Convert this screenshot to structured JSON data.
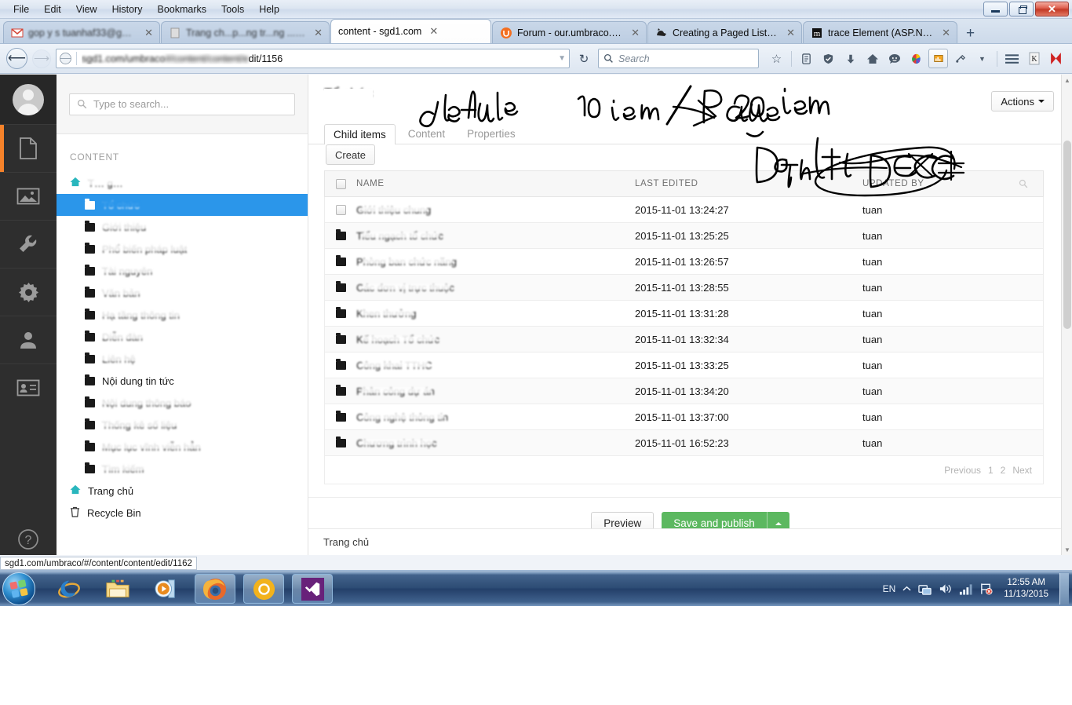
{
  "browser": {
    "menus": [
      "File",
      "Edit",
      "View",
      "History",
      "Bookmarks",
      "Tools",
      "Help"
    ],
    "window_controls": {
      "minimize": "Minimize",
      "restore": "Restore",
      "close": "Close"
    },
    "tabs": [
      {
        "title": "gop y s   tuanhaf33@gmc...",
        "favicon": "gmail-icon",
        "redacted": true,
        "active": false
      },
      {
        "title": "Trang ch...p...ng tr...ng ...n diểm",
        "favicon": "page-icon",
        "redacted": true,
        "active": false
      },
      {
        "title": "content - sgd1.com",
        "favicon": "none",
        "redacted": false,
        "active": true
      },
      {
        "title": "Forum - our.umbraco.org",
        "favicon": "umbraco-icon",
        "redacted": false,
        "active": false
      },
      {
        "title": "Creating a Paged List in U...",
        "favicon": "cat-icon",
        "redacted": false,
        "active": false
      },
      {
        "title": "trace Element (ASP.NET Se...",
        "favicon": "msdn-icon",
        "redacted": false,
        "active": false
      }
    ],
    "new_tab_label": "+",
    "address": {
      "prefix": "sgd1.com/umbraco",
      "middle": "#/content/content/e",
      "suffix": "dit/1156"
    },
    "search": {
      "placeholder": "Search"
    },
    "toolbar_icons": [
      "star-icon",
      "reader-icon",
      "shield-icon",
      "download-icon",
      "home-icon",
      "chat-icon",
      "colorpicker-icon",
      "screenshot-icon",
      "plugin-icon",
      "chevron-down-icon",
      "hamburger-menu-icon",
      "kaspersky-icon",
      "kaspersky-alert-icon"
    ],
    "status_url": "sgd1.com/umbraco/#/content/content/edit/1162"
  },
  "umbraco": {
    "rail": [
      {
        "name": "avatar",
        "label": "User avatar"
      },
      {
        "name": "content",
        "label": "Content",
        "active": true
      },
      {
        "name": "media",
        "label": "Media",
        "active": false
      },
      {
        "name": "developer",
        "label": "Developer",
        "active": false
      },
      {
        "name": "settings",
        "label": "Settings",
        "active": false
      },
      {
        "name": "users",
        "label": "Users",
        "active": false
      },
      {
        "name": "members",
        "label": "Members",
        "active": false
      },
      {
        "name": "help",
        "label": "Help",
        "active": false
      }
    ],
    "tree": {
      "search_placeholder": "Type to search...",
      "section_heading": "CONTENT",
      "items": [
        {
          "label": "T… g…",
          "icon": "home-icon",
          "depth": 0,
          "redacted": true,
          "selected": false
        },
        {
          "label": "Tổ chức",
          "icon": "folder-icon",
          "depth": 1,
          "redacted": true,
          "selected": true
        },
        {
          "label": "Giới thiệu",
          "icon": "folder-icon",
          "depth": 1,
          "redacted": true,
          "selected": false
        },
        {
          "label": "Phổ biến pháp luật",
          "icon": "folder-icon",
          "depth": 1,
          "redacted": true,
          "selected": false
        },
        {
          "label": "Tài nguyên",
          "icon": "folder-icon",
          "depth": 1,
          "redacted": true,
          "selected": false
        },
        {
          "label": "Văn bản",
          "icon": "folder-icon",
          "depth": 1,
          "redacted": true,
          "selected": false
        },
        {
          "label": "Hạ tầng thông tin",
          "icon": "folder-icon",
          "depth": 1,
          "redacted": true,
          "selected": false
        },
        {
          "label": "Diễn đàn",
          "icon": "folder-icon",
          "depth": 1,
          "redacted": true,
          "selected": false
        },
        {
          "label": "Liên hệ",
          "icon": "folder-icon",
          "depth": 1,
          "redacted": true,
          "selected": false
        },
        {
          "label": "Nội dung tin tức",
          "icon": "folder-icon",
          "depth": 1,
          "redacted": false,
          "selected": false
        },
        {
          "label": "Nội dung thông báo",
          "icon": "folder-icon",
          "depth": 1,
          "redacted": true,
          "selected": false
        },
        {
          "label": "Thống kê số liệu",
          "icon": "folder-icon",
          "depth": 1,
          "redacted": true,
          "selected": false
        },
        {
          "label": "Mục lục vĩnh viễn hẳn",
          "icon": "folder-icon",
          "depth": 1,
          "redacted": true,
          "selected": false
        },
        {
          "label": "Tìm kiếm",
          "icon": "folder-icon",
          "depth": 1,
          "redacted": true,
          "selected": false
        },
        {
          "label": "Trang chủ",
          "icon": "home-icon",
          "depth": 0,
          "redacted": false,
          "selected": false
        },
        {
          "label": "Recycle Bin",
          "icon": "trash-icon",
          "depth": 0,
          "redacted": false,
          "selected": false
        }
      ]
    },
    "node": {
      "title": "Tổ chức",
      "actions_label": "Actions",
      "tabs": [
        {
          "label": "Child items",
          "active": true
        },
        {
          "label": "Content",
          "active": false
        },
        {
          "label": "Properties",
          "active": false
        }
      ],
      "create_label": "Create"
    },
    "listview": {
      "columns": [
        "NAME",
        "LAST EDITED",
        "UPDATED BY"
      ],
      "search_icon": "search-icon",
      "rows": [
        {
          "name": "Giới thiệu chung",
          "last_edited": "2015-11-01 13:24:27",
          "updated_by": "tuan",
          "icon": "checkbox",
          "redacted": true
        },
        {
          "name": "Tiểu ngạch tổ chức",
          "last_edited": "2015-11-01 13:25:25",
          "updated_by": "tuan",
          "icon": "folder-icon",
          "redacted": true
        },
        {
          "name": "Phòng ban chức năng",
          "last_edited": "2015-11-01 13:26:57",
          "updated_by": "tuan",
          "icon": "folder-icon",
          "redacted": true
        },
        {
          "name": "Các đơn vị trực thuộc",
          "last_edited": "2015-11-01 13:28:55",
          "updated_by": "tuan",
          "icon": "folder-icon",
          "redacted": true
        },
        {
          "name": "Khen thưởng",
          "last_edited": "2015-11-01 13:31:28",
          "updated_by": "tuan",
          "icon": "folder-icon",
          "redacted": true
        },
        {
          "name": "Kế hoạch Tổ chức",
          "last_edited": "2015-11-01 13:32:34",
          "updated_by": "tuan",
          "icon": "folder-icon",
          "redacted": true
        },
        {
          "name": "Công khai TTHC",
          "last_edited": "2015-11-01 13:33:25",
          "updated_by": "tuan",
          "icon": "folder-icon",
          "redacted": true
        },
        {
          "name": "Phân công dự án",
          "last_edited": "2015-11-01 13:34:20",
          "updated_by": "tuan",
          "icon": "folder-icon",
          "redacted": true
        },
        {
          "name": "Công nghệ thông tin",
          "last_edited": "2015-11-01 13:37:00",
          "updated_by": "tuan",
          "icon": "folder-icon",
          "redacted": true
        },
        {
          "name": "Chương trình học",
          "last_edited": "2015-11-01 16:52:23",
          "updated_by": "tuan",
          "icon": "folder-icon",
          "redacted": true
        }
      ],
      "pagination": {
        "previous": "Previous",
        "pages": [
          "1",
          "2"
        ],
        "next": "Next",
        "current": "1"
      }
    },
    "footer": {
      "preview_label": "Preview",
      "publish_label": "Save and publish",
      "breadcrumb": "Trang chủ"
    },
    "colors": {
      "accent_orange": "#f5822a",
      "selected_blue": "#2b96ea",
      "publish_green": "#5cb860",
      "home_teal": "#29b6bd"
    }
  },
  "annotations": [
    {
      "text": "default 10 item / Page",
      "note": "handwriting above tabs"
    },
    {
      "text": "20 item",
      "note": "handwriting with arrow, top right"
    },
    {
      "text": "Default DESC",
      "note": "handwriting over LAST EDITED column"
    }
  ],
  "taskbar": {
    "start_label": "Start",
    "apps": [
      {
        "name": "internet-explorer",
        "running": false
      },
      {
        "name": "file-explorer",
        "running": false
      },
      {
        "name": "media-player",
        "running": false
      },
      {
        "name": "firefox",
        "running": true
      },
      {
        "name": "chrome",
        "running": true
      },
      {
        "name": "visual-studio",
        "running": true
      }
    ],
    "tray": {
      "language": "EN",
      "icons": [
        "show-hidden-icon",
        "network-transfer-icon",
        "volume-icon",
        "signal-icon",
        "action-center-alert-icon"
      ],
      "time": "12:55 AM",
      "date": "11/13/2015"
    }
  }
}
